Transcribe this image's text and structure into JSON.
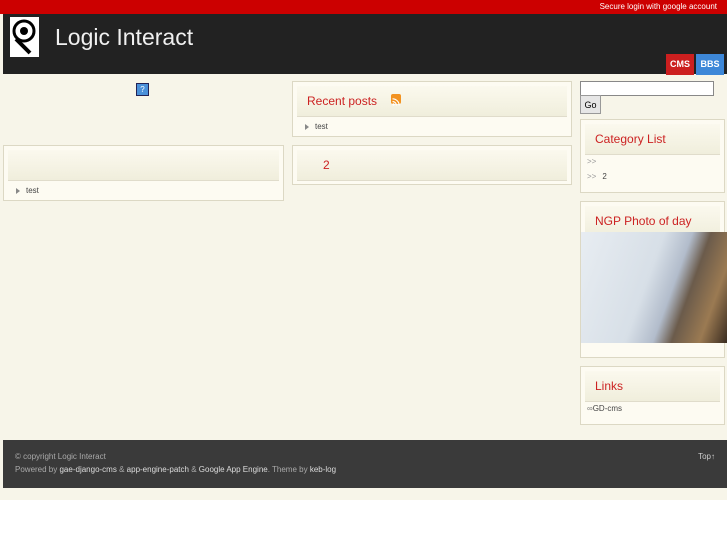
{
  "topbar": {
    "login_link": "Secure login with google account"
  },
  "header": {
    "site_title": "Logic Interact",
    "tags": {
      "cms": "CMS",
      "bbs": "BBS"
    }
  },
  "left_box": {
    "items": [
      "test"
    ]
  },
  "recent_posts": {
    "title": "Recent posts",
    "items": [
      "test"
    ]
  },
  "post_box": {
    "title": "2"
  },
  "sidebar": {
    "search_placeholder": "",
    "go_label": "Go",
    "category": {
      "title": "Category List",
      "items": [
        "",
        "2"
      ]
    },
    "photo": {
      "title": "NGP Photo of day"
    },
    "links": {
      "title": "Links",
      "items": [
        "GD-cms"
      ]
    }
  },
  "footer": {
    "copyright": "© copyright Logic Interact",
    "powered_by": "Powered by",
    "link1": "gae-django-cms",
    "amp1": "&",
    "link2": "app-engine-patch",
    "amp2": "&",
    "link3": "Google App Engine",
    "theme_by": ". Theme by",
    "link4": "keb-log",
    "top": "Top↑"
  }
}
